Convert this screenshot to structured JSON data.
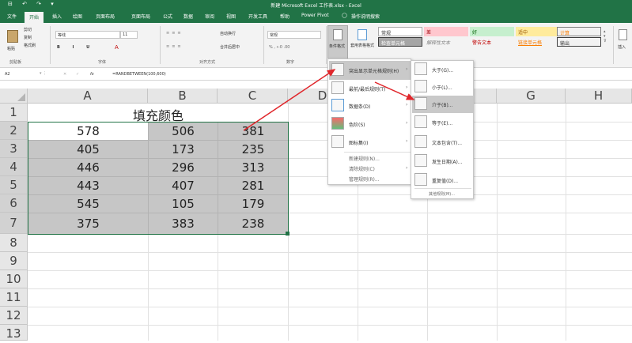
{
  "window": {
    "title": "新建 Microsoft Excel 工作表.xlsx  -  Excel",
    "quick_access": "⊟ ↶ ↷ ▾"
  },
  "tabs": [
    "文件",
    "开始",
    "插入",
    "绘图",
    "页面布局",
    "公式",
    "数据",
    "审阅",
    "视图",
    "开发工具",
    "帮助",
    "Power Pivot"
  ],
  "tell_me": "操作说明搜索",
  "ribbon": {
    "clipboard": {
      "paste": "粘贴",
      "cut": "剪切",
      "copy": "复制",
      "format_painter": "格式刷",
      "group": "剪贴板"
    },
    "font": {
      "name": "等线",
      "size": "11",
      "group": "字体"
    },
    "alignment": {
      "wrap": "自动换行",
      "merge": "合并后居中",
      "group": "对齐方式"
    },
    "number": {
      "format": "常规",
      "group": "数字"
    },
    "conditional_format": "条件格式",
    "table_format": "套用表格格式",
    "styles": {
      "normal": "常规",
      "bad": "差",
      "good": "好",
      "neutral": "适中",
      "calc": "计算",
      "check": "检查单元格",
      "explain": "解释性文本",
      "warn": "警告文本",
      "link": "链接单元格",
      "output": "输出"
    },
    "insert": "插入"
  },
  "formula": {
    "namebox": "A2",
    "fx": "fx",
    "content": "=RANDBETWEEN(100,600)"
  },
  "columns": [
    "A",
    "B",
    "C",
    "D",
    "E",
    "F",
    "G",
    "H"
  ],
  "rows": [
    "1",
    "2",
    "3",
    "4",
    "5",
    "6",
    "7",
    "8",
    "9",
    "10",
    "11",
    "12",
    "13"
  ],
  "title_cell": "填充颜色",
  "table": [
    [
      "578",
      "506",
      "381"
    ],
    [
      "405",
      "173",
      "235"
    ],
    [
      "446",
      "296",
      "313"
    ],
    [
      "443",
      "407",
      "281"
    ],
    [
      "545",
      "105",
      "179"
    ],
    [
      "375",
      "383",
      "238"
    ]
  ],
  "menu1": [
    "突出显示单元格规则(H)",
    "最前/最后规则(T)",
    "数据条(D)",
    "色阶(S)",
    "图标集(I)",
    "新建规则(N)...",
    "清除规则(C)",
    "管理规则(R)..."
  ],
  "menu2": [
    "大于(G)...",
    "小于(L)...",
    "介于(B)...",
    "等于(E)...",
    "文本包含(T)...",
    "发生日期(A)...",
    "重复值(D)..."
  ],
  "menu2_more": "其他规则(M)...",
  "colors": {
    "accent": "#217346",
    "selection": "#c6c6c6",
    "arrow": "#e0262b",
    "bad_bg": "#ffc7ce",
    "good_bg": "#c6efce",
    "neutral_bg": "#ffeb9c"
  }
}
